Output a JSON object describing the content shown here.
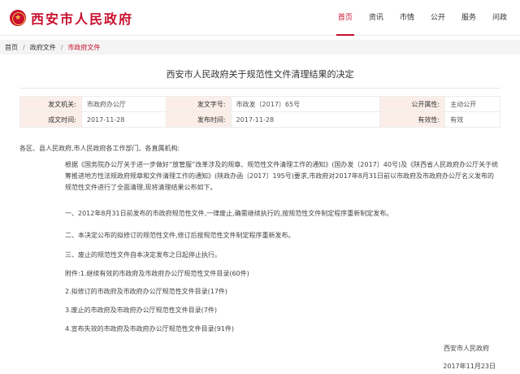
{
  "header": {
    "logo_text": "西安市人民政府",
    "nav": [
      "首页",
      "资讯",
      "市情",
      "公开",
      "服务",
      "问政"
    ],
    "active_nav": "首页"
  },
  "breadcrumb": [
    "首页",
    "政府文件",
    "市政府文件"
  ],
  "document": {
    "title": "西安市人民政府关于规范性文件清理结果的决定",
    "info": {
      "issuer_label": "发文机关:",
      "issuer": "市政府办公厅",
      "doc_no_label": "发文字号:",
      "doc_no": "市政发〔2017〕65号",
      "public_label": "公开属性:",
      "public": "主动公开",
      "created_label": "成文时间:",
      "created": "2017-11-28",
      "published_label": "发布时间:",
      "published": "2017-11-28",
      "validity_label": "有效性:",
      "validity": "有效"
    },
    "salutation": "各区、县人民政府,市人民政府各工作部门、各直属机构:",
    "paragraphs": [
      "根据《国务院办公厅关于进一步做好“放管服”改革涉及的规章、规范性文件清理工作的通知》(国办发〔2017〕40号)及《陕西省人民政府办公厅关于统筹推进地方性法规政府规章和文件清理工作的通知》(陕政办函〔2017〕195号)要求,市政府对2017年8月31日前以市政府及市政府办公厅名义发布的规范性文件进行了全面清理,现将清理结果公布如下。",
      "一、2012年8月31日前发布的市政府规范性文件,一律废止,确需继续执行的,按规范性文件制定程序重新制定发布。",
      "二、本决定公布的拟修订的规范性文件,修订后按规范性文件制定程序重新发布。",
      "三、废止的规范性文件自本决定发布之日起停止执行。"
    ],
    "attachments": [
      "附件:1.继续有效的市政府及市政府办公厅规范性文件目录(60件)",
      "2.拟修订的市政府及市政府办公厅规范性文件目录(17件)",
      "3.废止的市政府及市政府办公厅规范性文件目录(7件)",
      "4.宣布失效的市政府及市政府办公厅规范性文件目录(91件)"
    ],
    "signature": "西安市人民政府",
    "date": "2017年11月23日"
  }
}
